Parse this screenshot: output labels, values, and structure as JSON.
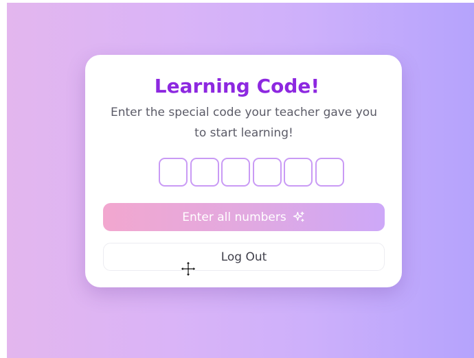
{
  "page": {
    "title": "Learning Code!",
    "subtitle": "Enter the special code your teacher gave you to start learning!"
  },
  "code_input": {
    "digits": [
      "",
      "",
      "",
      "",
      "",
      ""
    ],
    "digit_count": 6
  },
  "buttons": {
    "enter_label": "Enter all numbers",
    "enter_icon": "sparkle-icon",
    "logout_label": "Log Out"
  },
  "colors": {
    "title": "#8d28e0",
    "accent_border": "#c99af5",
    "background_left": "#e3b6ee",
    "background_right": "#b5a3fc",
    "button_left": "#f2a7cf",
    "button_right": "#cda8f8"
  },
  "cursor": {
    "icon": "move-cursor-icon"
  }
}
